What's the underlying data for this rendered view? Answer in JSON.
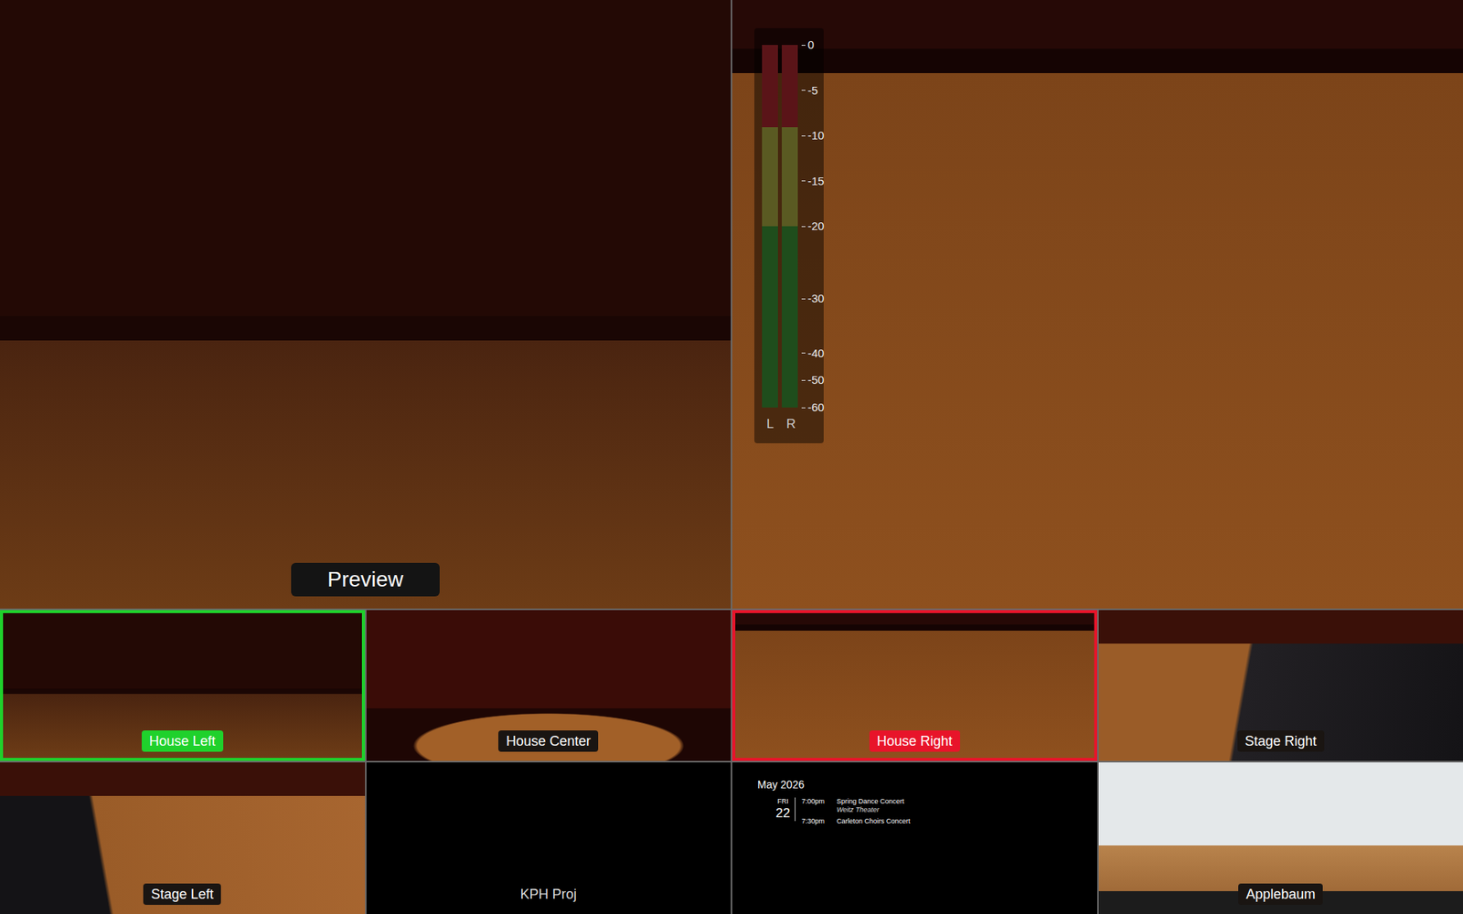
{
  "preview": {
    "label": "Preview"
  },
  "program": {
    "meter": {
      "channels": [
        {
          "name": "L",
          "level": 0
        },
        {
          "name": "R",
          "level": 0
        }
      ],
      "scale": [
        "0",
        "-5",
        "-10",
        "-15",
        "-20",
        "-30",
        "-40",
        "-50",
        "-60"
      ]
    }
  },
  "tiles": [
    {
      "kind": "camera",
      "label": "House Left",
      "tally": "preview"
    },
    {
      "kind": "camera",
      "label": "House Center",
      "tally": "none"
    },
    {
      "kind": "camera",
      "label": "House Right",
      "tally": "program"
    },
    {
      "kind": "camera",
      "label": "Stage Right",
      "tally": "none"
    },
    {
      "kind": "camera",
      "label": "Stage Left",
      "tally": "none"
    },
    {
      "kind": "blank",
      "label": "KPH Proj",
      "tally": "none"
    },
    {
      "kind": "calendar",
      "tally": "none",
      "calendar": {
        "month": "May 2026",
        "days": [
          {
            "weekday": "FRI",
            "day": "22",
            "events": [
              {
                "time": "7:00pm",
                "title": "Spring Dance Concert",
                "venue": "Weitz Theater"
              },
              {
                "time": "7:30pm",
                "title": "Carleton Choirs Concert",
                "venue": ""
              }
            ]
          }
        ]
      }
    },
    {
      "kind": "camera",
      "label": "Applebaum",
      "tally": "none"
    }
  ]
}
